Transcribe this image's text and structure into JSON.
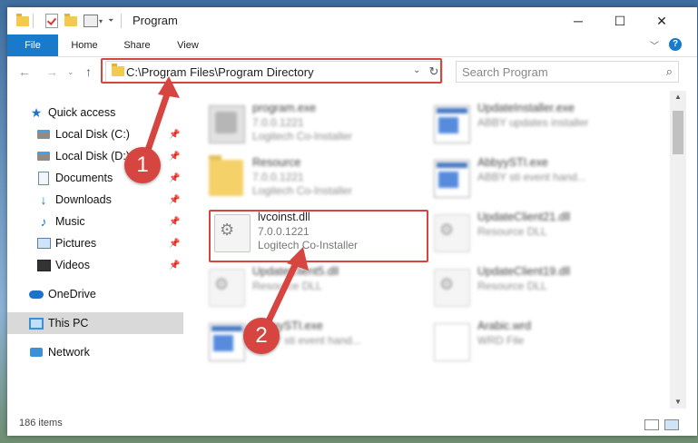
{
  "window": {
    "title": "Program"
  },
  "ribbon": {
    "tabs": [
      "File",
      "Home",
      "Share",
      "View"
    ]
  },
  "address": {
    "path": "C:\\Program Files\\Program Directory"
  },
  "search": {
    "placeholder": "Search Program"
  },
  "nav": {
    "items": [
      {
        "label": "Quick access",
        "icon": "star-icon"
      },
      {
        "label": "Local Disk (C:)",
        "icon": "drive-icon",
        "pinned": true
      },
      {
        "label": "Local Disk (D:)",
        "icon": "drive-icon",
        "pinned": true
      },
      {
        "label": "Documents",
        "icon": "document-icon",
        "pinned": true
      },
      {
        "label": "Downloads",
        "icon": "download-icon",
        "pinned": true
      },
      {
        "label": "Music",
        "icon": "music-icon",
        "pinned": true
      },
      {
        "label": "Pictures",
        "icon": "pictures-icon",
        "pinned": true
      },
      {
        "label": "Videos",
        "icon": "videos-icon",
        "pinned": true
      },
      {
        "label": "OneDrive",
        "icon": "cloud-icon"
      },
      {
        "label": "This PC",
        "icon": "computer-icon",
        "selected": true
      },
      {
        "label": "Network",
        "icon": "network-icon"
      }
    ]
  },
  "files": [
    {
      "name": "program.exe",
      "line2": "7.0.0.1221",
      "line3": "Logitech Co-Installer",
      "icon": "exe-icon"
    },
    {
      "name": "UpdateInstaller.exe",
      "line2": "ABBY updates installer",
      "line3": "",
      "icon": "exe-icon"
    },
    {
      "name": "Resource",
      "line2": "7.0.0.1221",
      "line3": "Logitech Co-Installer",
      "icon": "folder-icon"
    },
    {
      "name": "AbbyySTI.exe",
      "line2": "ABBY sti event hand...",
      "line3": "",
      "icon": "exe-icon"
    },
    {
      "name": "lvcoinst.dll",
      "line2": "7.0.0.1221",
      "line3": "Logitech Co-Installer",
      "icon": "dll-icon"
    },
    {
      "name": "UpdateClient21.dll",
      "line2": "Resource DLL",
      "line3": "",
      "icon": "dll-icon"
    },
    {
      "name": "UpdateClient5.dll",
      "line2": "Resource DLL",
      "line3": "",
      "icon": "dll-icon"
    },
    {
      "name": "UpdateClient19.dll",
      "line2": "Resource DLL",
      "line3": "",
      "icon": "dll-icon"
    },
    {
      "name": "AbbyySTI.exe",
      "line2": "ABBY sti event hand...",
      "line3": "",
      "icon": "exe-icon"
    },
    {
      "name": "Arabic.wrd",
      "line2": "WRD File",
      "line3": "",
      "icon": "file-icon"
    }
  ],
  "status": {
    "count": "186 items"
  },
  "callouts": {
    "one": "1",
    "two": "2"
  },
  "colors": {
    "accent": "#1979ca",
    "highlight": "#d64540"
  }
}
